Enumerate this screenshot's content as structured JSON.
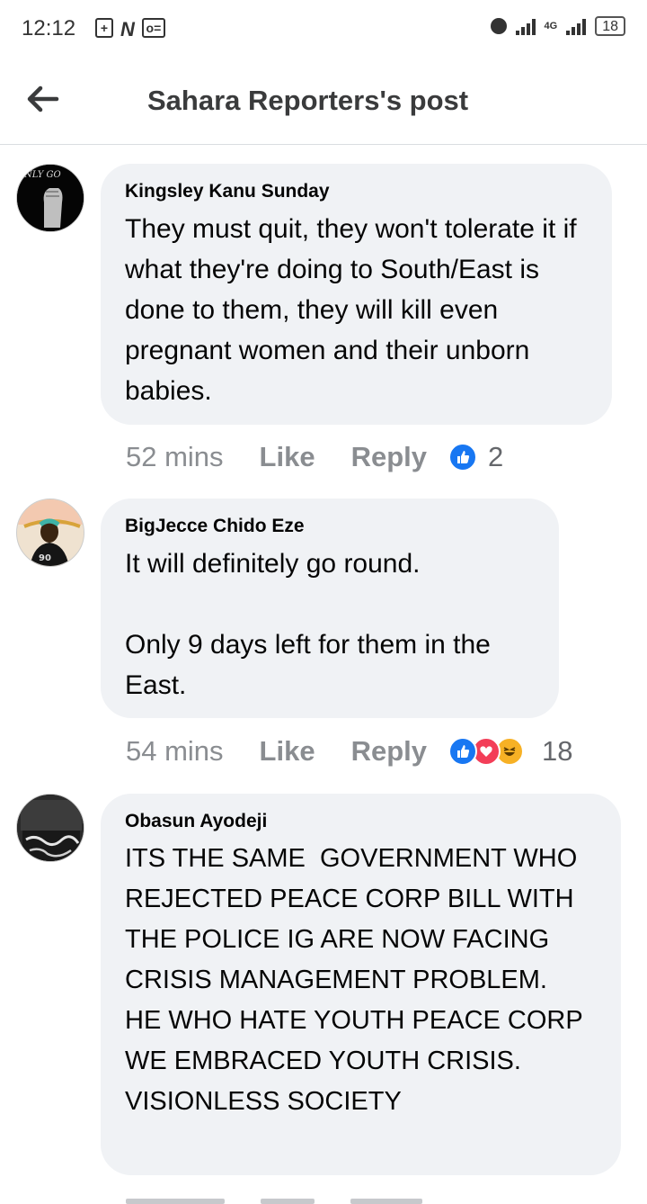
{
  "status_bar": {
    "time": "12:12",
    "network": "4G",
    "battery": "18"
  },
  "header": {
    "title": "Sahara Reporters's post"
  },
  "comments": [
    {
      "author": "Kingsley Kanu Sunday",
      "text": "They must quit, they won't tolerate it if what they're doing to South/East is done to them, they will kill even pregnant women and their unborn babies.",
      "time": "52 mins",
      "like_label": "Like",
      "reply_label": "Reply",
      "reactions": [
        "like"
      ],
      "reaction_count": "2",
      "avatar_text": "NLY GO"
    },
    {
      "author": "BigJecce Chido Eze",
      "text": "It will definitely go round.\n\nOnly 9 days left for them in the East.",
      "time": "54 mins",
      "like_label": "Like",
      "reply_label": "Reply",
      "reactions": [
        "like",
        "love",
        "haha"
      ],
      "reaction_count": "18"
    },
    {
      "author": "Obasun Ayodeji",
      "text": "ITS THE SAME  GOVERNMENT WHO REJECTED PEACE CORP BILL WITH THE POLICE IG ARE NOW FACING CRISIS MANAGEMENT PROBLEM.\nHE WHO HATE YOUTH PEACE CORP WE EMBRACED YOUTH CRISIS. VISIONLESS SOCIETY"
    }
  ],
  "colors": {
    "bubble": "#f0f2f5",
    "like_blue": "#1877f2",
    "love_red": "#f33e58",
    "haha_yellow": "#f7b125",
    "meta_gray": "#8a8d91"
  }
}
